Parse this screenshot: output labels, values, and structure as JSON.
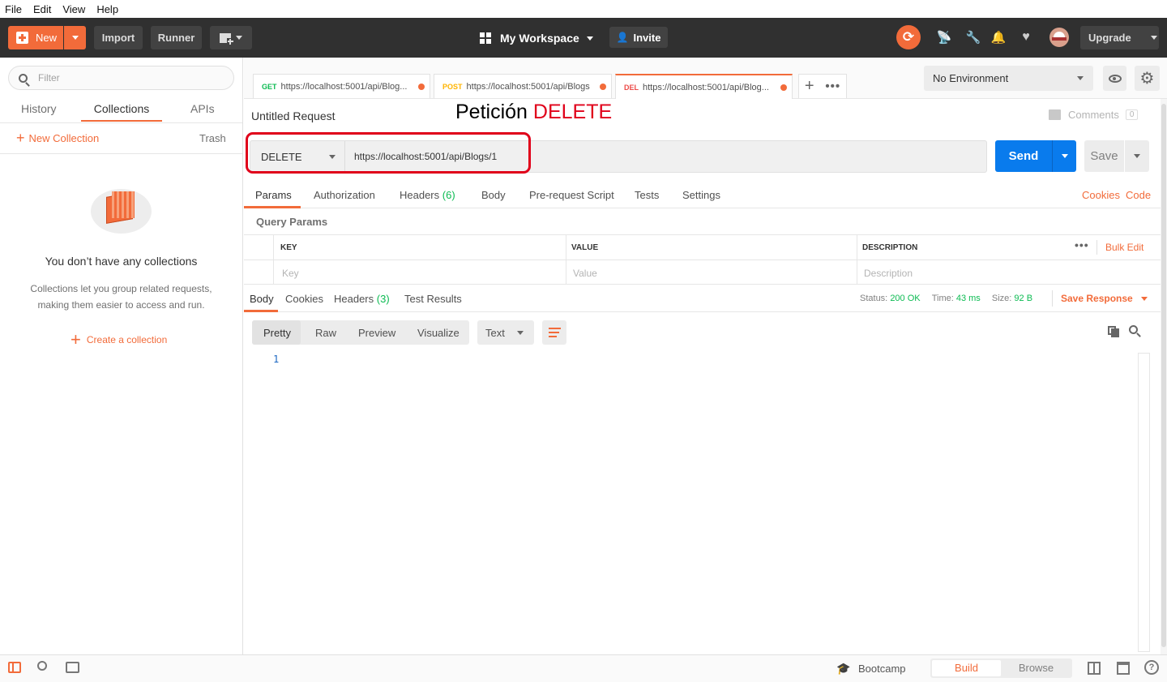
{
  "menu": [
    "File",
    "Edit",
    "View",
    "Help"
  ],
  "toolbar": {
    "new_label": "New",
    "import_label": "Import",
    "runner_label": "Runner",
    "workspace_label": "My Workspace",
    "invite_label": "Invite",
    "upgrade_label": "Upgrade"
  },
  "sidebar": {
    "filter_placeholder": "Filter",
    "tabs": [
      "History",
      "Collections",
      "APIs"
    ],
    "new_collection": "New Collection",
    "trash": "Trash",
    "empty_title": "You don’t have any collections",
    "empty_desc_1": "Collections let you group related requests,",
    "empty_desc_2": "making them easier to access and run.",
    "create_label": "Create a collection"
  },
  "tabs": [
    {
      "method": "GET",
      "url": "https://localhost:5001/api/Blog...",
      "color": "#0cbb52"
    },
    {
      "method": "POST",
      "url": "https://localhost:5001/api/Blogs",
      "color": "#ffb400"
    },
    {
      "method": "DEL",
      "url": "https://localhost:5001/api/Blog...",
      "color": "#ed4b48"
    }
  ],
  "environment": "No Environment",
  "request": {
    "title": "Untitled Request",
    "annotation_prefix": "Petición",
    "annotation_method": "DELETE",
    "comments_label": "Comments",
    "comments_count": "0",
    "method": "DELETE",
    "url": "https://localhost:5001/api/Blogs/1",
    "send_label": "Send",
    "save_label": "Save"
  },
  "req_tabs": {
    "params": "Params",
    "authorization": "Authorization",
    "headers": "Headers",
    "headers_count": "(6)",
    "body": "Body",
    "prerequest": "Pre-request Script",
    "tests": "Tests",
    "settings": "Settings",
    "cookies": "Cookies",
    "code": "Code"
  },
  "query": {
    "title": "Query Params",
    "col_key": "KEY",
    "col_value": "VALUE",
    "col_desc": "DESCRIPTION",
    "bulk_edit": "Bulk Edit",
    "ph_key": "Key",
    "ph_value": "Value",
    "ph_desc": "Description"
  },
  "response": {
    "tabs": {
      "body": "Body",
      "cookies": "Cookies",
      "headers": "Headers",
      "headers_count": "(3)",
      "tests": "Test Results"
    },
    "status_label": "Status:",
    "status_value": "200 OK",
    "time_label": "Time:",
    "time_value": "43 ms",
    "size_label": "Size:",
    "size_value": "92 B",
    "save_response": "Save Response",
    "views": [
      "Pretty",
      "Raw",
      "Preview",
      "Visualize"
    ],
    "format": "Text",
    "line_number": "1"
  },
  "statusbar": {
    "bootcamp": "Bootcamp",
    "build": "Build",
    "browse": "Browse"
  },
  "colors": {
    "accent": "#f26b3a",
    "send": "#097bed",
    "topbar": "#303030",
    "annotation": "#e0001a"
  }
}
